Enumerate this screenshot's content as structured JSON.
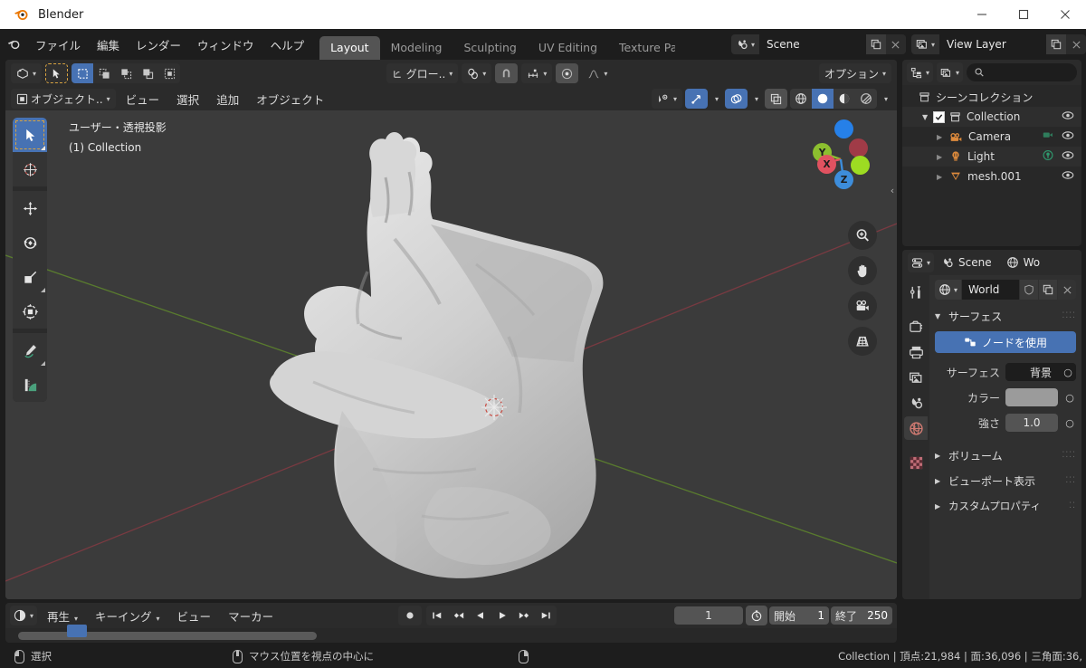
{
  "window": {
    "app_title": "Blender",
    "logo_icon": "blender-logo-icon",
    "minimize_icon": "minimize-icon",
    "maximize_icon": "maximize-icon",
    "close_icon": "close-icon"
  },
  "topbar": {
    "logo_icon": "blender-menu-icon",
    "menus": [
      {
        "label": "ファイル"
      },
      {
        "label": "編集"
      },
      {
        "label": "レンダー"
      },
      {
        "label": "ウィンドウ"
      },
      {
        "label": "ヘルプ"
      }
    ],
    "workspace_tabs": [
      {
        "label": "Layout",
        "active": true
      },
      {
        "label": "Modeling",
        "active": false
      },
      {
        "label": "Sculpting",
        "active": false
      },
      {
        "label": "UV Editing",
        "active": false
      },
      {
        "label": "Texture Paint",
        "active": false
      }
    ],
    "scene": {
      "icon": "scene-icon",
      "name": "Scene",
      "new_icon": "duplicate-icon",
      "remove_icon": "x-icon"
    },
    "view_layer": {
      "icon": "view-layer-icon",
      "name": "View Layer",
      "new_icon": "duplicate-icon",
      "remove_icon": "x-icon"
    }
  },
  "viewport": {
    "header": {
      "editor_type_icon": "editor-type-3dview-icon",
      "mode_icon": "object-mode-icon",
      "mode_label": "オブジェクト..",
      "transform_orientation_icon": "orientation-icon",
      "transform_orientation_label": "グロー..",
      "snap_icon": "magnet-icon",
      "snap_target_icon": "snap-increment-icon",
      "proportional_icon": "proportional-edit-icon",
      "falloff_icon": "smooth-falloff-icon",
      "options_label": "オプション",
      "select_tool_icon": "tweak-select-icon",
      "select_modes": [
        {
          "icon": "select-box-icon",
          "active": true
        },
        {
          "icon": "select-extend-icon",
          "active": false
        },
        {
          "icon": "select-subtract-icon",
          "active": false
        },
        {
          "icon": "select-invert-icon",
          "active": false
        },
        {
          "icon": "select-intersect-icon",
          "active": false
        }
      ],
      "menus": [
        {
          "label": "ビュー"
        },
        {
          "label": "選択"
        },
        {
          "label": "追加"
        },
        {
          "label": "オブジェクト"
        }
      ],
      "visibility_icon": "object-visibility-icon",
      "gizmo_icon": "gizmo-icon",
      "overlays_icon": "overlays-icon",
      "xray_icon": "xray-toggle-icon",
      "shading_modes": [
        {
          "icon": "shading-wireframe-icon",
          "active": false
        },
        {
          "icon": "shading-solid-icon",
          "active": true
        },
        {
          "icon": "shading-material-icon",
          "active": false
        },
        {
          "icon": "shading-rendered-icon",
          "active": false
        }
      ]
    },
    "overlay_text_line1": "ユーザー・透視投影",
    "overlay_text_line2": "(1) Collection",
    "tools": [
      {
        "icon": "tweak-tool-icon",
        "selected": true
      },
      {
        "icon": "cursor-tool-icon",
        "selected": false
      },
      {
        "icon": "move-tool-icon",
        "selected": false
      },
      {
        "icon": "rotate-tool-icon",
        "selected": false
      },
      {
        "icon": "scale-tool-icon",
        "selected": false
      },
      {
        "icon": "transform-tool-icon",
        "selected": false
      },
      {
        "icon": "annotate-tool-icon",
        "selected": false
      },
      {
        "icon": "measure-tool-icon",
        "selected": false
      }
    ],
    "gizmo": {
      "axes": [
        {
          "label": "X",
          "color": "#e05260"
        },
        {
          "label": "Y",
          "color": "#8cbf2f"
        },
        {
          "label": "Z",
          "color": "#3d8ddb"
        },
        {
          "label": "",
          "color": "#a03b47"
        },
        {
          "label": "",
          "color": "#9ddc22"
        },
        {
          "label": "",
          "color": "#2680e8"
        }
      ]
    },
    "nav_buttons": [
      {
        "icon": "zoom-icon"
      },
      {
        "icon": "pan-hand-icon"
      },
      {
        "icon": "camera-view-icon"
      },
      {
        "icon": "toggle-perspective-icon"
      }
    ],
    "sidebar_toggle_icon": "chevron-left-icon"
  },
  "outliner": {
    "editor_type_icon": "editor-type-outliner-icon",
    "display_mode_icon": "outliner-display-mode-icon",
    "search_icon": "search-icon",
    "search_placeholder": "",
    "root_label": "シーンコレクション",
    "root_icon": "collection-icon",
    "items": [
      {
        "label": "Collection",
        "icon": "collection-icon",
        "indent": 1,
        "checkbox": true,
        "disclosure": "down",
        "eye_icon": "eye-icon",
        "extra_icon": ""
      },
      {
        "label": "Camera",
        "icon": "camera-data-icon",
        "indent": 2,
        "checkbox": false,
        "disclosure": "right",
        "eye_icon": "eye-icon",
        "extra_icon": "camera-object-icon"
      },
      {
        "label": "Light",
        "icon": "light-data-icon",
        "indent": 2,
        "checkbox": false,
        "disclosure": "right",
        "eye_icon": "eye-icon",
        "extra_icon": "light-object-icon"
      },
      {
        "label": "mesh.001",
        "icon": "mesh-data-icon",
        "indent": 2,
        "checkbox": false,
        "disclosure": "right",
        "eye_icon": "eye-icon",
        "extra_icon": ""
      }
    ]
  },
  "properties": {
    "editor_type_icon": "editor-type-properties-icon",
    "breadcrumb": [
      {
        "icon": "scene-icon",
        "label": "Scene"
      },
      {
        "icon": "world-icon",
        "label": "Wo"
      }
    ],
    "tabs": [
      {
        "icon": "tool-icon",
        "selected": false
      },
      {
        "icon": "render-icon",
        "selected": false
      },
      {
        "icon": "output-icon",
        "selected": false
      },
      {
        "icon": "view-layer-icon",
        "selected": false
      },
      {
        "icon": "scene-icon",
        "selected": false
      },
      {
        "icon": "world-icon",
        "selected": true
      },
      {
        "icon": "texture-icon",
        "selected": false
      }
    ],
    "id_block": {
      "icon": "world-icon",
      "name": "World",
      "fake_user_icon": "shield-icon",
      "new_icon": "duplicate-icon",
      "unlink_icon": "x-icon"
    },
    "panels": [
      {
        "label": "サーフェス",
        "open": true
      },
      {
        "label": "ボリューム",
        "open": false
      },
      {
        "label": "ビューポート表示",
        "open": false
      },
      {
        "label": "カスタムプロパティ",
        "open": false
      }
    ],
    "use_nodes_button": {
      "label": "ノードを使用",
      "icon": "nodetree-icon"
    },
    "fields": [
      {
        "label": "サーフェス",
        "value": "背景",
        "type": "dropdown"
      },
      {
        "label": "カラー",
        "value": "",
        "type": "color",
        "color": "#9b9b9b"
      },
      {
        "label": "強さ",
        "value": "1.0",
        "type": "number"
      }
    ]
  },
  "timeline": {
    "editor_type_icon": "editor-type-timeline-icon",
    "menus": [
      {
        "label": "再生",
        "has_arrow": true
      },
      {
        "label": "キーイング",
        "has_arrow": true
      },
      {
        "label": "ビュー",
        "has_arrow": false
      },
      {
        "label": "マーカー",
        "has_arrow": false
      }
    ],
    "record_icon": "record-icon",
    "playback_buttons": [
      {
        "icon": "jump-to-start-icon"
      },
      {
        "icon": "prev-keyframe-icon"
      },
      {
        "icon": "play-reverse-icon"
      },
      {
        "icon": "play-icon"
      },
      {
        "icon": "next-keyframe-icon"
      },
      {
        "icon": "jump-to-end-icon"
      }
    ],
    "current_frame": "1",
    "clock_icon": "clock-icon",
    "start_label": "開始",
    "start_value": "1",
    "end_label": "終了",
    "end_value": "250"
  },
  "statusbar": {
    "left_mouse_icon": "mouse-left-icon",
    "left_label": "選択",
    "middle_mouse_icon": "mouse-middle-icon",
    "middle_label": "マウス位置を視点の中心に",
    "right_mouse_icon": "mouse-right-icon",
    "stats": "Collection | 頂点:21,984 | 面:36,096 | 三角面:36,"
  },
  "theme": {
    "accent": "#4772b3",
    "bg_dark": "#1d1d1d",
    "bg_panel": "#303030",
    "bg_header": "#2b2b2b",
    "viewport_bg": "#3b3b3b",
    "text": "#e5e5e5"
  }
}
